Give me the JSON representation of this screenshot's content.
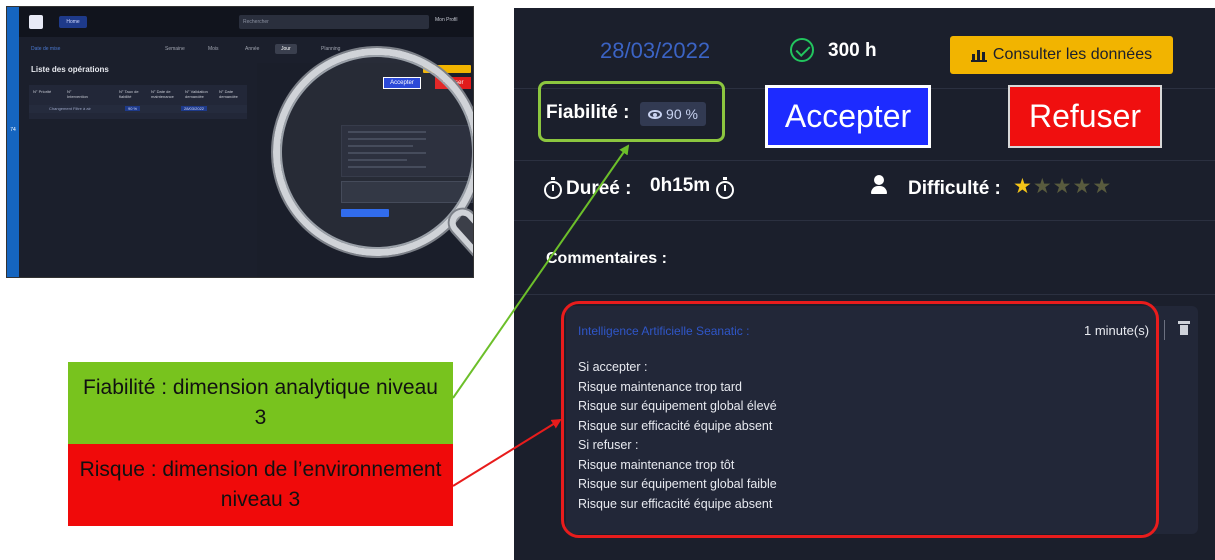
{
  "thumbnail": {
    "home_chip": "Home",
    "search_placeholder": "Rechercher",
    "user": "Mon Profil",
    "date": "Date de mise",
    "nav": [
      "Semaine",
      "Mois",
      "Année",
      "Jour",
      "Planning"
    ],
    "list_title": "Liste des opérations",
    "headers": [
      "N° Priorité",
      "N° Intervention",
      "N° Taux de fiabilité",
      "N° Date de maintenance",
      "N° Validation demandée",
      "N° Date demandée"
    ],
    "row": [
      "Changement Filtre à air",
      "90 %",
      "28/03/2022"
    ],
    "accept_label": "Accepter",
    "refuse_label": "Refuser",
    "sidebar_label": "74"
  },
  "panel": {
    "date": "28/03/2022",
    "hours": "300 h",
    "consult_label": "Consulter les données",
    "fiabilite_label": "Fiabilité :",
    "fiabilite_value": "90 %",
    "accept_label": "Accepter",
    "refuse_label": "Refuser",
    "duree_label": "Dureé :",
    "duree_value": "0h15m",
    "difficulte_label": "Difficulté :",
    "difficulte_stars": 1,
    "difficulte_max": 5,
    "commentaires_label": "Commentaires :",
    "ai_author": "Intelligence Artificielle Seanatic :",
    "ai_time": "1 minute(s)",
    "ai_lines": [
      "Si accepter :",
      "Risque maintenance trop tard",
      "Risque sur équipement global élevé",
      "Risque sur efficacité équipe absent",
      "Si refuser :",
      "Risque maintenance trop tôt",
      "Risque sur équipement global faible",
      "Risque sur efficacité équipe absent"
    ]
  },
  "legend": {
    "green_text": "Fiabilité : dimension analytique niveau 3",
    "red_text": "Risque : dimension de l’environnement niveau 3"
  },
  "colors": {
    "accent_blue": "#1d2bff",
    "refuse_red": "#f00f0f",
    "consult_yellow": "#f2b400",
    "legend_green": "#78c31e",
    "legend_red": "#f00a0a"
  }
}
